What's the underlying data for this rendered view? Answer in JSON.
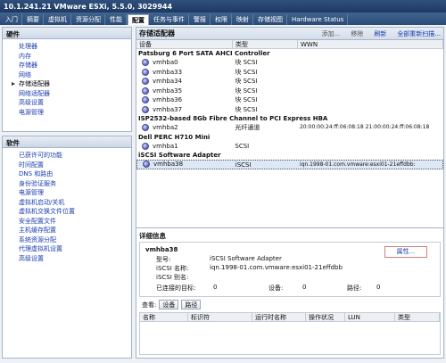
{
  "window": {
    "title": "10.1.241.21 VMware ESXi, 5.5.0, 3029944"
  },
  "tabs": [
    "入门",
    "摘要",
    "虚拟机",
    "资源分配",
    "性能",
    "配置",
    "任务与事件",
    "警报",
    "权限",
    "映射",
    "存储视图",
    "Hardware Status"
  ],
  "active_tab_index": 5,
  "hardware": {
    "title": "硬件",
    "items": [
      "处理器",
      "内存",
      "存储器",
      "网络",
      "存储适配器",
      "网络适配器",
      "高级设置",
      "电源管理"
    ],
    "selected_index": 4
  },
  "software": {
    "title": "软件",
    "items": [
      "已获许可的功能",
      "时间配置",
      "DNS 和路由",
      "身份验证服务",
      "电源管理",
      "虚拟机启动/关机",
      "虚拟机交换文件位置",
      "安全配置文件",
      "主机缓存配置",
      "系统资源分配",
      "代理虚拟机设置",
      "高级设置"
    ]
  },
  "main": {
    "title": "存储适配器",
    "toolbar": {
      "add": "添加...",
      "remove": "移除",
      "refresh": "刷新",
      "rescan_all": "全部重新扫描..."
    },
    "columns": [
      "设备",
      "类型",
      "WWN"
    ],
    "groups": [
      {
        "name": "Patsburg 6 Port SATA AHCI Controller",
        "rows": [
          {
            "device": "vmhba0",
            "type": "块 SCSI",
            "wwn": ""
          },
          {
            "device": "vmhba33",
            "type": "块 SCSI",
            "wwn": ""
          },
          {
            "device": "vmhba34",
            "type": "块 SCSI",
            "wwn": ""
          },
          {
            "device": "vmhba35",
            "type": "块 SCSI",
            "wwn": ""
          },
          {
            "device": "vmhba36",
            "type": "块 SCSI",
            "wwn": ""
          },
          {
            "device": "vmhba37",
            "type": "块 SCSI",
            "wwn": ""
          }
        ]
      },
      {
        "name": "ISP2532-based 8Gb Fibre Channel to PCI Express HBA",
        "rows": [
          {
            "device": "vmhba2",
            "type": "光纤通道",
            "wwn": "20:00:00:24:ff:06:08:18 21:00:00:24:ff:06:08:18"
          }
        ]
      },
      {
        "name": "Dell PERC H710 Mini",
        "rows": [
          {
            "device": "vmhba1",
            "type": "SCSI",
            "wwn": ""
          }
        ]
      },
      {
        "name": "iSCSI Software Adapter",
        "rows": [
          {
            "device": "vmhba38",
            "type": "iSCSI",
            "wwn": "iqn.1998-01.com.vmware:esxi01-21effdbb:"
          }
        ]
      }
    ]
  },
  "details": {
    "title": "详细信息",
    "adapter_name": "vmhba38",
    "properties_link": "属性...",
    "model_label": "型号:",
    "model_value": "iSCSI Software Adapter",
    "iscsi_name_label": "iSCSI 名称:",
    "iscsi_name_value": "iqn.1998-01.com.vmware:esxi01-21effdbb",
    "iscsi_alias_label": "iSCSI 别名:",
    "targets_label": "已连接的目标:",
    "targets_value": "0",
    "devices_label": "设备:",
    "devices_value": "0",
    "paths_label": "路径:",
    "paths_value": "0",
    "view_label": "查看:",
    "view_devices": "设备",
    "view_paths": "路径",
    "bottom_columns": [
      "名称",
      "标识符",
      "运行时名称",
      "操作状况",
      "LUN",
      "类型"
    ]
  }
}
